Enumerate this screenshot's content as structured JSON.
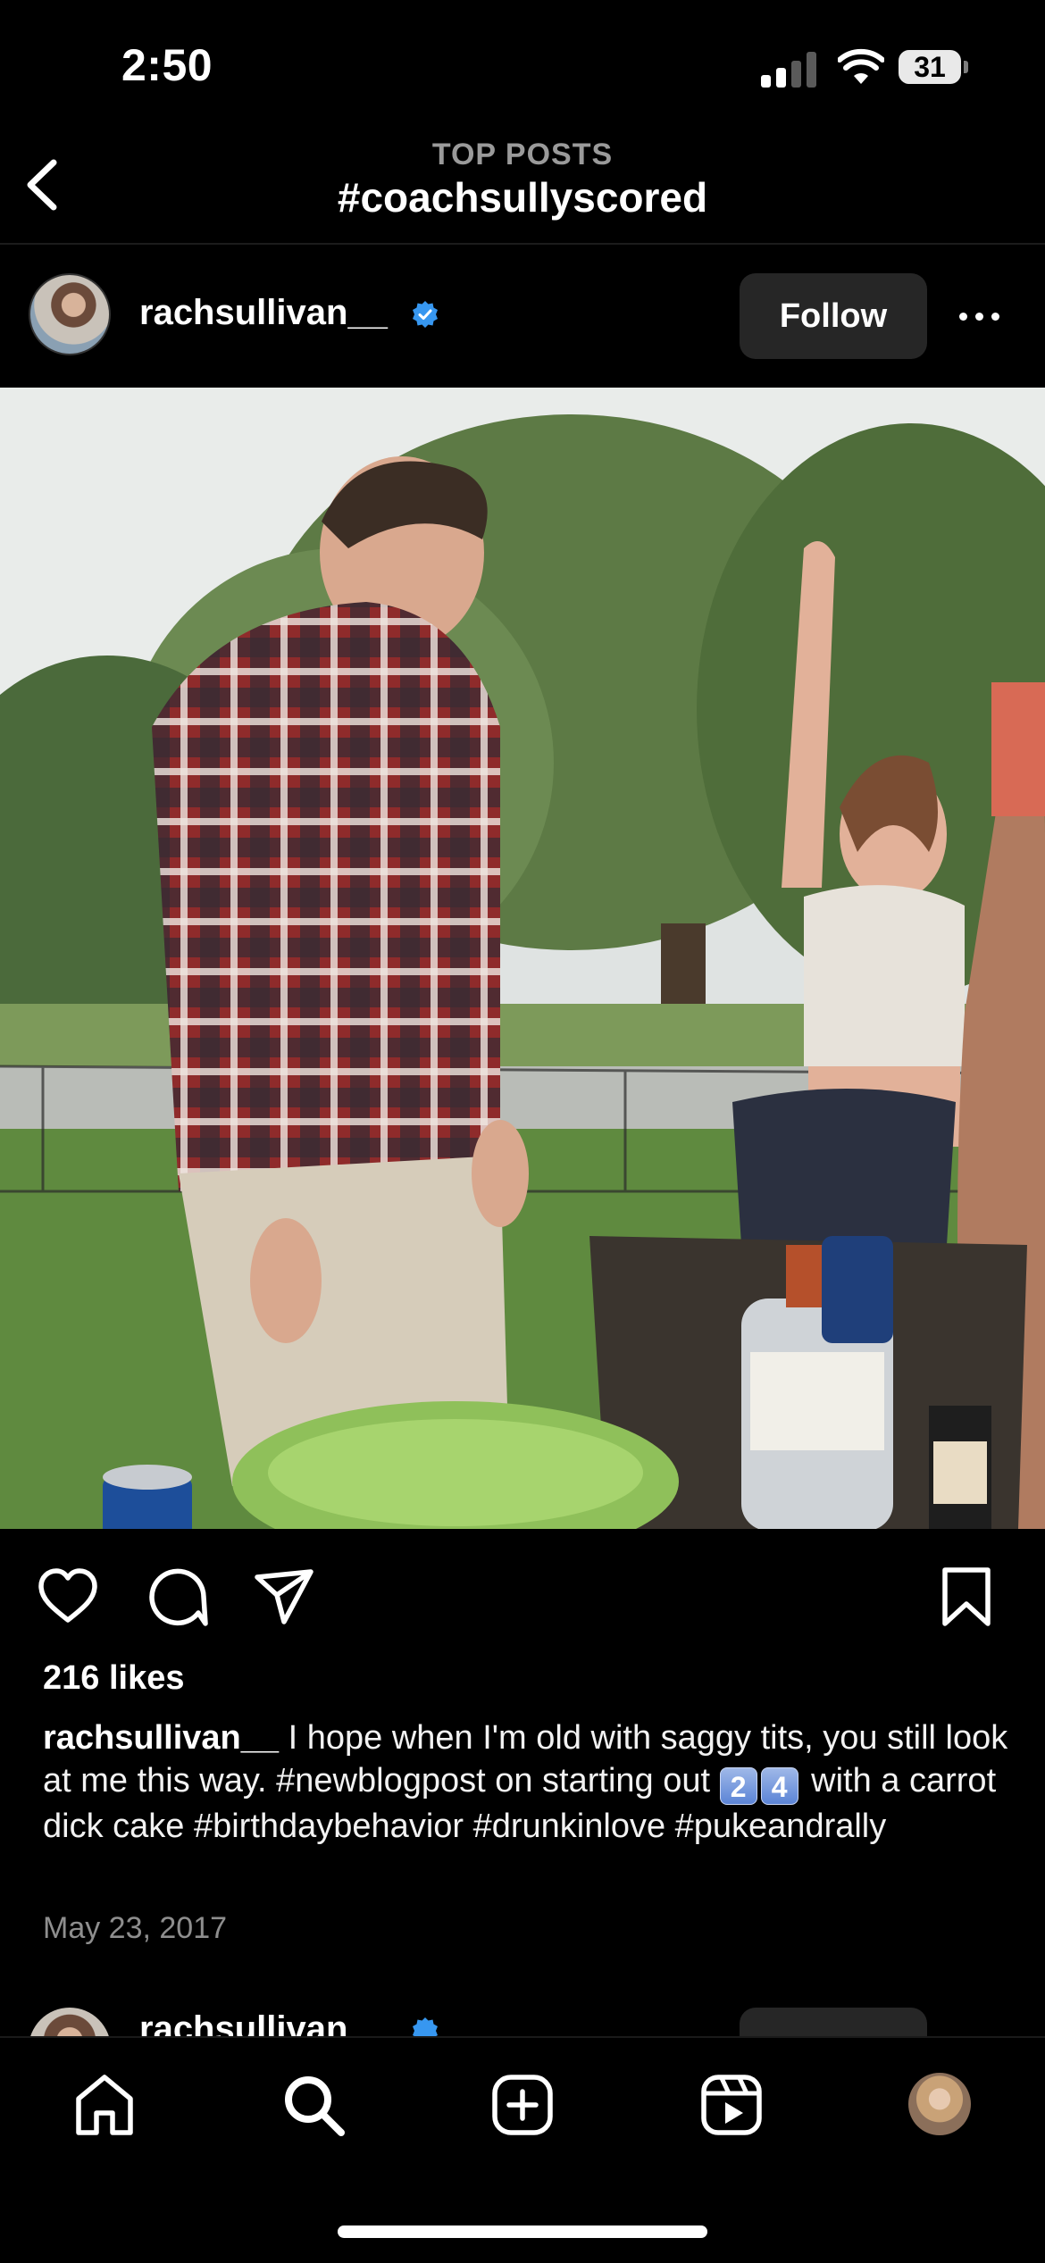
{
  "status_bar": {
    "time": "2:50",
    "battery": "31"
  },
  "header": {
    "subtitle": "TOP POSTS",
    "title": "#coachsullyscored"
  },
  "post": {
    "username": "rachsullivan__",
    "follow_label": "Follow",
    "likes": "216 likes",
    "caption_user": "rachsullivan__",
    "caption_text_1": " I hope when I'm old with saggy tits, you still look at me this way. #newblogpost on starting out ",
    "keycap_1": "2",
    "keycap_2": "4",
    "caption_text_2": " with a carrot dick cake #birthdaybehavior #drunkinlove #pukeandrally",
    "date": "May 23, 2017"
  },
  "next_post": {
    "username": "rachsullivan__"
  },
  "icons": {
    "back": "chevron-left-icon",
    "verified": "verified-badge-icon",
    "more": "more-horizontal-icon",
    "like": "heart-icon",
    "comment": "comment-icon",
    "share": "send-icon",
    "save": "bookmark-icon",
    "tabs": [
      "home-icon",
      "search-icon",
      "create-icon",
      "reels-icon",
      "profile-avatar"
    ]
  },
  "colors": {
    "background": "#000000",
    "follow_button": "#262626",
    "verified": "#3797f0",
    "muted_text": "#8e8e8e"
  }
}
